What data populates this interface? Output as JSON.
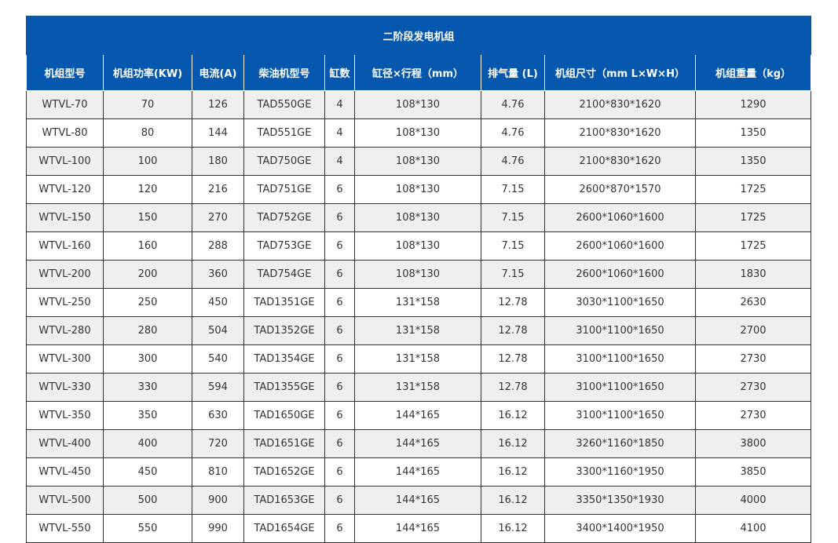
{
  "table": {
    "title": "二阶段发电机组",
    "headers": [
      "机组型号",
      "机组功率(KW)",
      "电流(A)",
      "柴油机型号",
      "缸数",
      "缸径×行程（mm）",
      "排气量 (L)",
      "机组尺寸（mm L×W×H）",
      "机组重量（kg）"
    ],
    "rows": [
      [
        "WTVL-70",
        "70",
        "126",
        "TAD550GE",
        "4",
        "108*130",
        "4.76",
        "2100*830*1620",
        "1290"
      ],
      [
        "WTVL-80",
        "80",
        "144",
        "TAD551GE",
        "4",
        "108*130",
        "4.76",
        "2100*830*1620",
        "1350"
      ],
      [
        "WTVL-100",
        "100",
        "180",
        "TAD750GE",
        "4",
        "108*130",
        "4.76",
        "2100*830*1620",
        "1350"
      ],
      [
        "WTVL-120",
        "120",
        "216",
        "TAD751GE",
        "6",
        "108*130",
        "7.15",
        "2600*870*1570",
        "1725"
      ],
      [
        "WTVL-150",
        "150",
        "270",
        "TAD752GE",
        "6",
        "108*130",
        "7.15",
        "2600*1060*1600",
        "1725"
      ],
      [
        "WTVL-160",
        "160",
        "288",
        "TAD753GE",
        "6",
        "108*130",
        "7.15",
        "2600*1060*1600",
        "1725"
      ],
      [
        "WTVL-200",
        "200",
        "360",
        "TAD754GE",
        "6",
        "108*130",
        "7.15",
        "2600*1060*1600",
        "1830"
      ],
      [
        "WTVL-250",
        "250",
        "450",
        "TAD1351GE",
        "6",
        "131*158",
        "12.78",
        "3030*1100*1650",
        "2630"
      ],
      [
        "WTVL-280",
        "280",
        "504",
        "TAD1352GE",
        "6",
        "131*158",
        "12.78",
        "3100*1100*1650",
        "2700"
      ],
      [
        "WTVL-300",
        "300",
        "540",
        "TAD1354GE",
        "6",
        "131*158",
        "12.78",
        "3100*1100*1650",
        "2730"
      ],
      [
        "WTVL-330",
        "330",
        "594",
        "TAD1355GE",
        "6",
        "131*158",
        "12.78",
        "3100*1100*1650",
        "2730"
      ],
      [
        "WTVL-350",
        "350",
        "630",
        "TAD1650GE",
        "6",
        "144*165",
        "16.12",
        "3100*1100*1650",
        "2730"
      ],
      [
        "WTVL-400",
        "400",
        "720",
        "TAD1651GE",
        "6",
        "144*165",
        "16.12",
        "3260*1160*1850",
        "3800"
      ],
      [
        "WTVL-450",
        "450",
        "810",
        "TAD1652GE",
        "6",
        "144*165",
        "16.12",
        "3300*1160*1950",
        "3850"
      ],
      [
        "WTVL-500",
        "500",
        "900",
        "TAD1653GE",
        "6",
        "144*165",
        "16.12",
        "3350*1350*1930",
        "4000"
      ],
      [
        "WTVL-550",
        "550",
        "990",
        "TAD1654GE",
        "6",
        "144*165",
        "16.12",
        "3400*1400*1950",
        "4100"
      ]
    ]
  },
  "colors": {
    "header_bg": "#0558ad",
    "header_text": "#ffffff",
    "row_alt_bg": "#efefef",
    "row_bg": "#ffffff",
    "cell_text": "#333333"
  }
}
